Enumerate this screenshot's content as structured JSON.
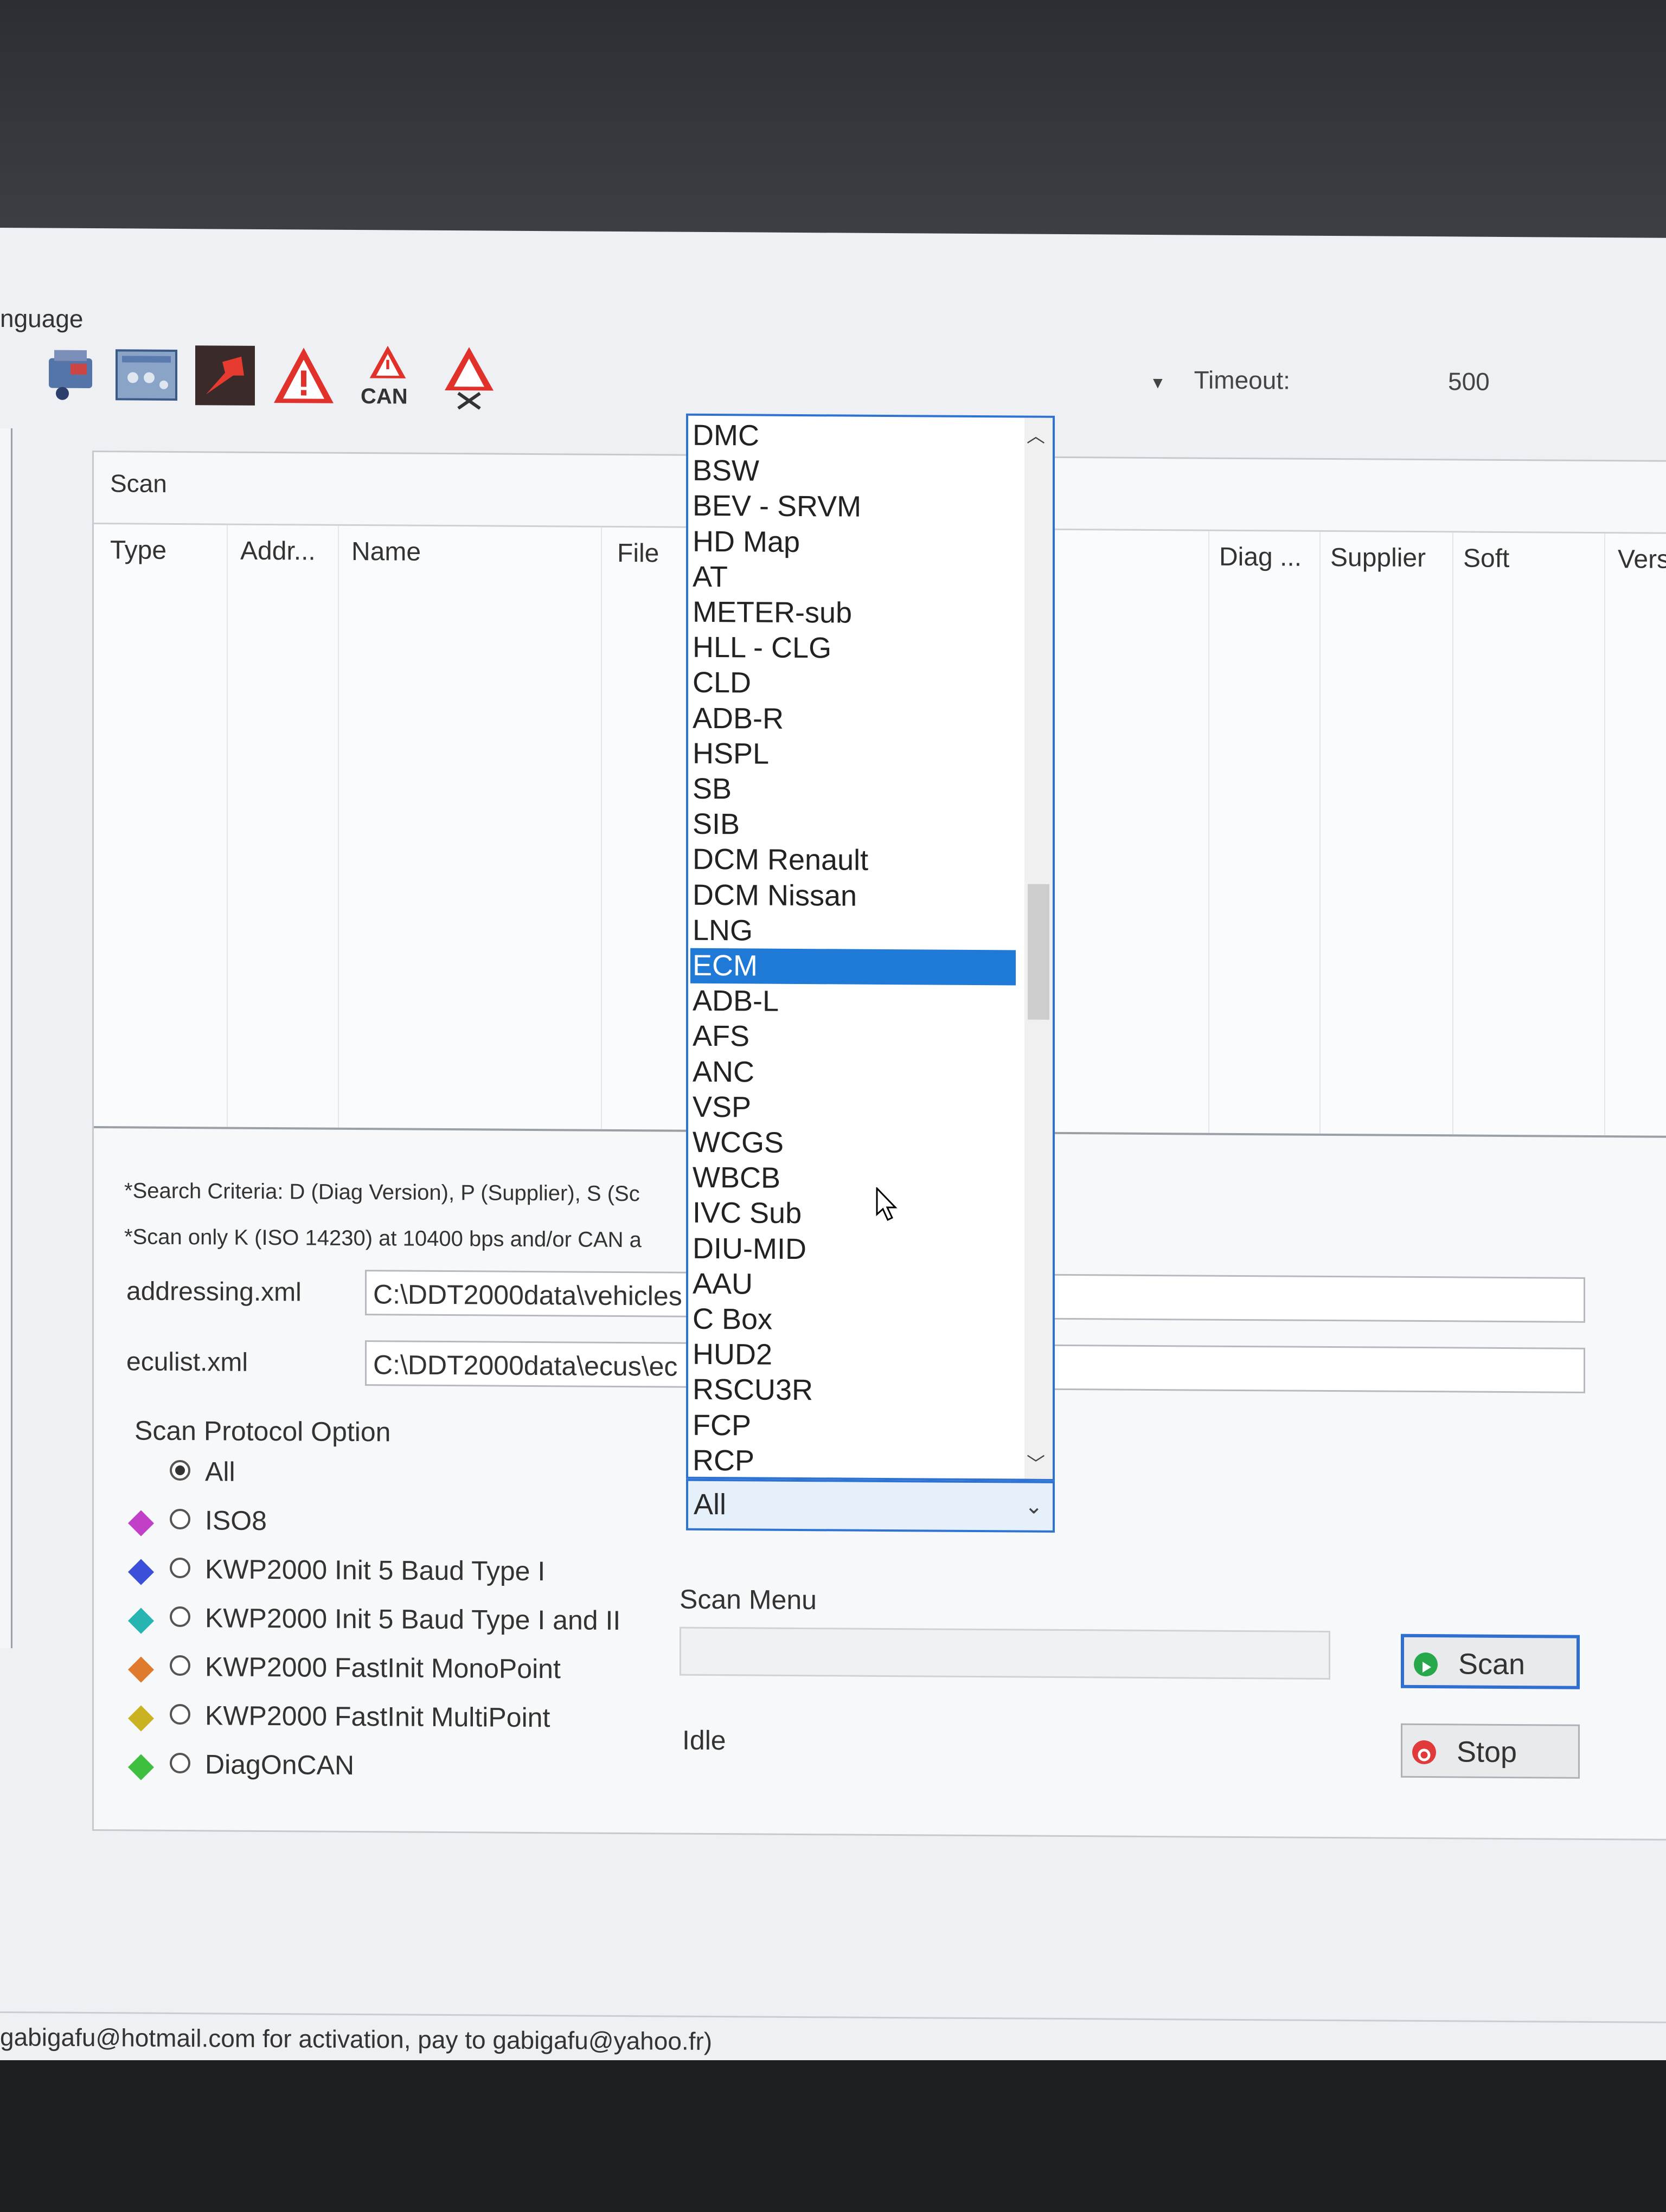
{
  "menu": {
    "language_partial": "nguage"
  },
  "toolbar": {
    "icons": [
      "ecu-chip-icon",
      "settings-panel-icon",
      "pin-icon",
      "warning-icon",
      "can-warning-icon",
      "warning-clear-icon"
    ],
    "can_label": "CAN",
    "timeout_label": "Timeout:",
    "timeout_value": "500"
  },
  "scan_panel": {
    "title": "Scan",
    "columns": [
      "Type",
      "Addr...",
      "Name",
      "File",
      "Diag ...",
      "Supplier",
      "Soft",
      "Vers"
    ]
  },
  "notes": [
    "*Search Criteria: D (Diag Version), P (Supplier), S (Sc",
    "*Scan only K (ISO 14230) at 10400 bps and/or CAN a"
  ],
  "fields": {
    "addressing_label": "addressing.xml",
    "addressing_value": "C:\\DDT2000data\\vehicles",
    "eculist_label": "eculist.xml",
    "eculist_value": "C:\\DDT2000data\\ecus\\ec"
  },
  "protocol": {
    "title": "Scan Protocol Option",
    "options": [
      {
        "label": "All",
        "selected": true,
        "color": ""
      },
      {
        "label": "ISO8",
        "selected": false,
        "color": "#c23fc8"
      },
      {
        "label": "KWP2000 Init 5 Baud Type I",
        "selected": false,
        "color": "#3b4fd8"
      },
      {
        "label": "KWP2000 Init 5 Baud Type I and II",
        "selected": false,
        "color": "#26b5b0"
      },
      {
        "label": "KWP2000 FastInit MonoPoint",
        "selected": false,
        "color": "#e07a2c"
      },
      {
        "label": "KWP2000 FastInit MultiPoint",
        "selected": false,
        "color": "#c9b323"
      },
      {
        "label": "DiagOnCAN",
        "selected": false,
        "color": "#3fbf3f"
      }
    ]
  },
  "scan_menu": {
    "label": "Scan Menu",
    "status": "Idle"
  },
  "buttons": {
    "scan": "Scan",
    "stop": "Stop"
  },
  "dropdown": {
    "items": [
      "DMC",
      "BSW",
      "BEV - SRVM",
      "HD Map",
      "AT",
      "METER-sub",
      "HLL - CLG",
      "CLD",
      "ADB-R",
      "HSPL",
      "SB",
      "SIB",
      "DCM Renault",
      "DCM Nissan",
      "LNG",
      "ECM",
      "ADB-L",
      "AFS",
      "ANC",
      "VSP",
      "WCGS",
      "WBCB",
      "IVC Sub",
      "DIU-MID",
      "AAU",
      "C Box",
      "HUD2",
      "RSCU3R",
      "FCP",
      "RCP"
    ],
    "selected": "ECM",
    "combo_value": "All"
  },
  "footer": {
    "text": "gabigafu@hotmail.com for activation, pay to gabigafu@yahoo.fr)"
  },
  "colors": {
    "accent": "#2e72d2",
    "selection": "#1e7ad6",
    "scan_icon": "#27a84a",
    "stop_icon": "#e03a3a"
  }
}
